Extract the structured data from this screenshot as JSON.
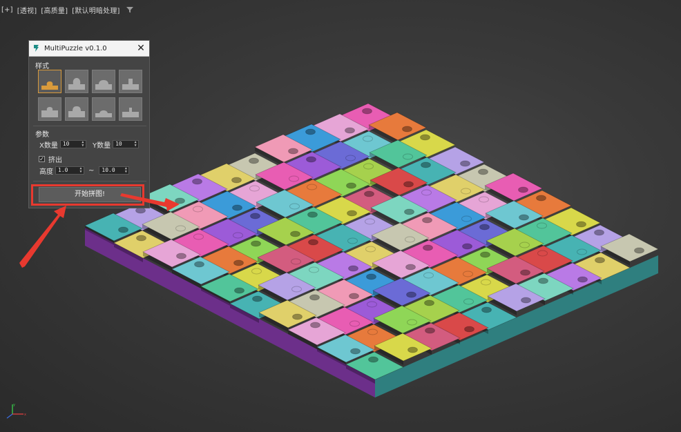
{
  "viewport": {
    "labels": [
      "[+]",
      "[透视]",
      "[高质量]",
      "[默认明暗处理]"
    ],
    "filter_icon": "filter-icon"
  },
  "dialog": {
    "title": "MultiPuzzle v0.1.0",
    "close_label": "✕",
    "style_section_label": "样式",
    "style_options": [
      "knob-top-1",
      "knob-top-2",
      "knob-top-3",
      "knob-top-4",
      "knob-bottom-1",
      "knob-bottom-2",
      "knob-bottom-3",
      "knob-bottom-4"
    ],
    "selected_style_index": 0,
    "params_section_label": "参数",
    "x_count_label": "X数量",
    "x_count_value": "10",
    "y_count_label": "Y数量",
    "y_count_value": "10",
    "extrude_label": "挤出",
    "extrude_checked": true,
    "height_label": "高度",
    "height_min": "1.0",
    "range_dash": "~",
    "height_max": "10.0",
    "start_button_label": "开始拼图!"
  },
  "annotations": {
    "highlight_color": "#e8392f"
  },
  "colors": {
    "selected_style": "#d99b3c",
    "panel": "#444444",
    "titlebar": "#f3f3f3"
  }
}
